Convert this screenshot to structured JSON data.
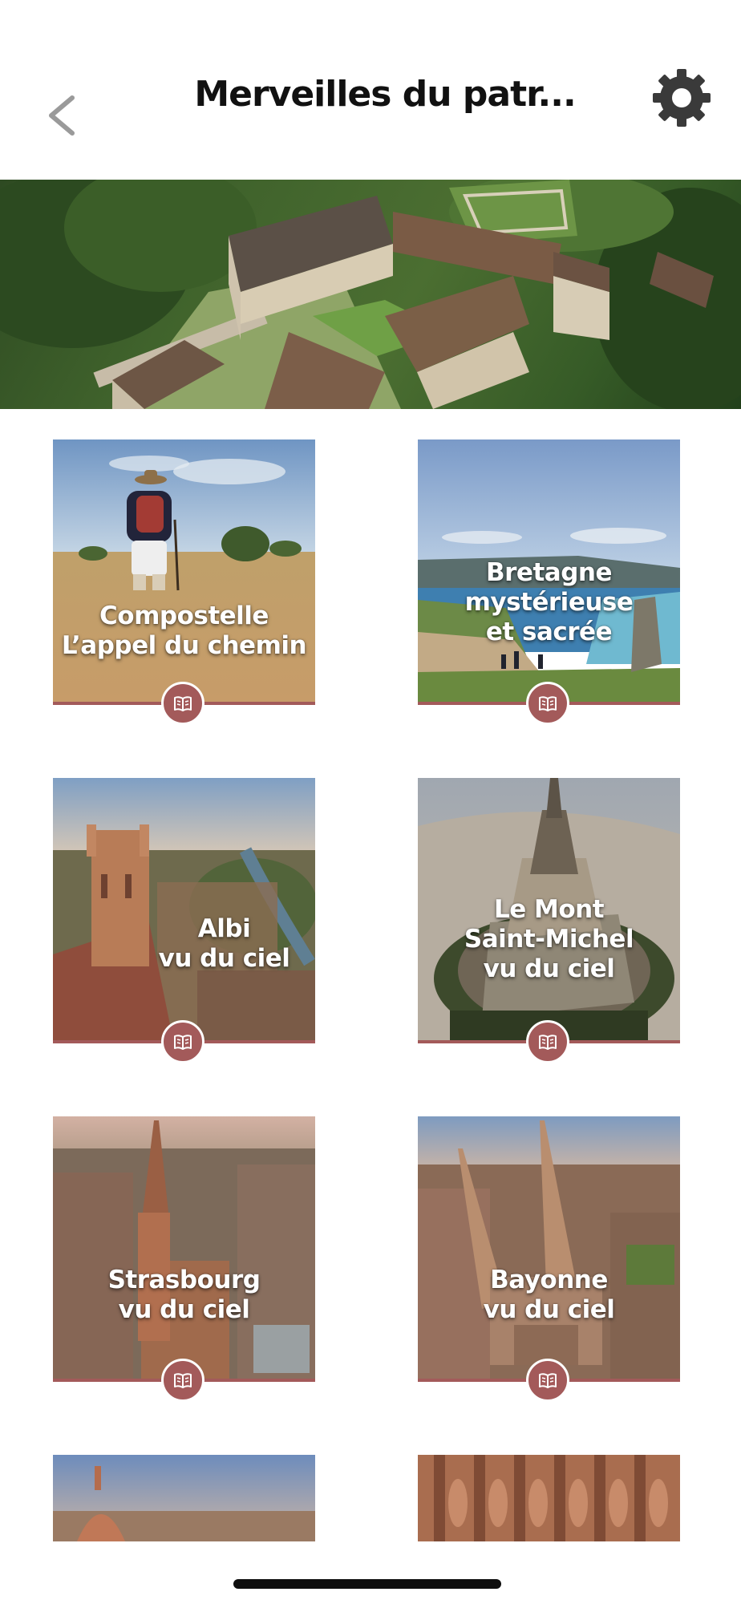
{
  "header": {
    "title": "Merveilles du patr...",
    "back_icon": "chevron-left-icon",
    "settings_icon": "gear-icon"
  },
  "hero": {
    "description_icon": "abbey-aerial-photo"
  },
  "cards": [
    {
      "id": "compostelle",
      "lines": [
        "Compostelle",
        "L’appel du chemin"
      ]
    },
    {
      "id": "bretagne",
      "lines": [
        "Bretagne",
        "mystérieuse",
        "et sacrée"
      ]
    },
    {
      "id": "albi",
      "lines": [
        "Albi",
        "vu du ciel"
      ]
    },
    {
      "id": "mont-saint-michel",
      "lines": [
        "Le Mont",
        "Saint-Michel",
        "vu du ciel"
      ]
    },
    {
      "id": "strasbourg",
      "lines": [
        "Strasbourg",
        "vu du ciel"
      ]
    },
    {
      "id": "bayonne",
      "lines": [
        "Bayonne",
        "vu du ciel"
      ]
    }
  ],
  "colors": {
    "accent": "#a35a5a",
    "title": "#111111",
    "back_chevron": "#9a9a9a",
    "gear": "#3a3a3a"
  },
  "icons": {
    "badge": "book-icon"
  }
}
